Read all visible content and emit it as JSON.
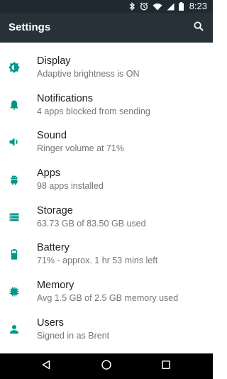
{
  "status_bar": {
    "time": "8:23",
    "icons": [
      "bluetooth-icon",
      "alarm-icon",
      "wifi-icon",
      "cell-signal-icon",
      "battery-icon"
    ]
  },
  "app_bar": {
    "title": "Settings",
    "search_icon": "search-icon"
  },
  "colors": {
    "accent": "#009688",
    "app_bar": "#263238",
    "status_bar": "#1f2a30",
    "title_text": "#212121",
    "summary_text": "#757575"
  },
  "settings": [
    {
      "title": "Display",
      "summary": "Adaptive brightness is ON",
      "icon": "brightness-icon"
    },
    {
      "title": "Notifications",
      "summary": "4 apps blocked from sending",
      "icon": "bell-icon"
    },
    {
      "title": "Sound",
      "summary": "Ringer volume at 71%",
      "icon": "volume-icon"
    },
    {
      "title": "Apps",
      "summary": "98 apps installed",
      "icon": "android-icon"
    },
    {
      "title": "Storage",
      "summary": "63.73 GB of 83.50 GB used",
      "icon": "storage-icon"
    },
    {
      "title": "Battery",
      "summary": "71% - approx. 1 hr 53 mins left",
      "icon": "battery-icon"
    },
    {
      "title": "Memory",
      "summary": "Avg 1.5 GB of 2.5 GB memory used",
      "icon": "memory-icon"
    },
    {
      "title": "Users",
      "summary": "Signed in as Brent",
      "icon": "person-icon"
    }
  ],
  "nav_bar": {
    "icons": [
      "back-icon",
      "home-icon",
      "recents-icon"
    ]
  }
}
